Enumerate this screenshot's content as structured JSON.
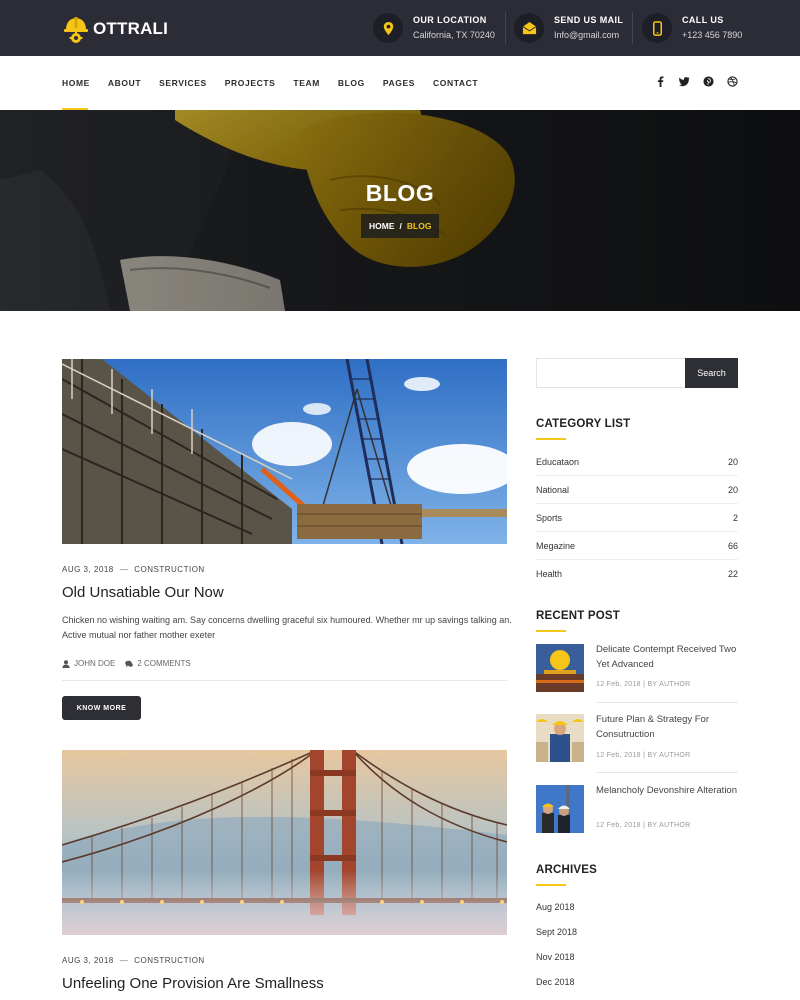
{
  "brand": {
    "name": "OTTRALI"
  },
  "contacts": [
    {
      "label": "OUR LOCATION",
      "value": "California, TX 70240",
      "icon": "location-pin-icon"
    },
    {
      "label": "SEND US MAIL",
      "value": "Info@gmail.com",
      "icon": "mail-icon"
    },
    {
      "label": "CALL US",
      "value": "+123 456 7890",
      "icon": "phone-icon"
    }
  ],
  "nav": {
    "items": [
      "HOME",
      "ABOUT",
      "SERVICES",
      "PROJECTS",
      "TEAM",
      "BLOG",
      "PAGES",
      "CONTACT"
    ],
    "social": [
      "facebook-icon",
      "twitter-icon",
      "pinterest-icon",
      "dribbble-icon"
    ]
  },
  "hero": {
    "title": "BLOG",
    "crumb_home": "HOME",
    "crumb_sep": "/",
    "crumb_current": "BLOG"
  },
  "posts": [
    {
      "date": "AUG 3, 2018",
      "category": "CONSTRUCTION",
      "title": "Old Unsatiable Our Now",
      "excerpt": "Chicken no wishing waiting am. Say concerns dwelling graceful six humoured. Whether mr up savings talking an. Active mutual nor father mother exeter",
      "author": "JOHN DOE",
      "comments": "2 COMMENTS",
      "button": "KNOW MORE"
    },
    {
      "date": "AUG 3, 2018",
      "category": "CONSTRUCTION",
      "title": "Unfeeling One Provision Are Smallness"
    }
  ],
  "sidebar": {
    "search_button": "Search",
    "category_title": "CATEGORY LIST",
    "categories": [
      {
        "name": "Educataon",
        "count": "20"
      },
      {
        "name": "National",
        "count": "20"
      },
      {
        "name": "Sports",
        "count": "2"
      },
      {
        "name": "Megazine",
        "count": "66"
      },
      {
        "name": "Health",
        "count": "22"
      }
    ],
    "recent_title": "RECENT POST",
    "recent": [
      {
        "title": "Delicate Contempt Received Two Yet Advanced",
        "meta": "12 Feb, 2018 | BY AUTHOR"
      },
      {
        "title": "Future Plan & Strategy For Consutruction",
        "meta": "12 Feb, 2018 | BY AUTHOR"
      },
      {
        "title": "Melancholy Devonshire Alteration",
        "meta": "12 Feb, 2018 | BY AUTHOR"
      }
    ],
    "archives_title": "ARCHIVES",
    "archives": [
      "Aug 2018",
      "Sept 2018",
      "Nov 2018",
      "Dec 2018"
    ]
  },
  "colors": {
    "accent": "#f5c518",
    "dark": "#2b2c35"
  }
}
